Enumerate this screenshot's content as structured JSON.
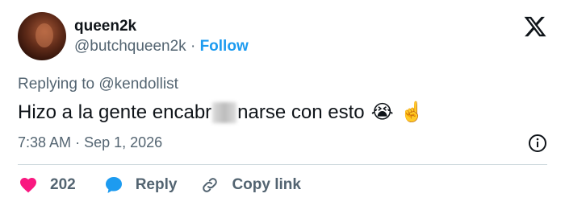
{
  "user": {
    "display_name": "queen2k",
    "handle": "@butchqueen2k",
    "separator": "·",
    "follow_label": "Follow"
  },
  "reply": {
    "prefix": "Replying to",
    "target": "@kendollist"
  },
  "tweet": {
    "text_before": "Hizo a la gente encabr",
    "text_after": "narse con esto",
    "emoji_1": "😭",
    "emoji_2": "☝️"
  },
  "meta": {
    "time": "7:38 AM",
    "separator": "·",
    "date": "Sep 1, 2026"
  },
  "actions": {
    "like_count": "202",
    "reply_label": "Reply",
    "copy_link_label": "Copy link"
  },
  "colors": {
    "accent": "#1d9bf0",
    "like": "#f91880",
    "text": "#0f1419",
    "muted": "#536471"
  },
  "icons": [
    "x-logo-icon",
    "info-icon",
    "heart-icon",
    "reply-bubble-icon",
    "link-icon"
  ]
}
